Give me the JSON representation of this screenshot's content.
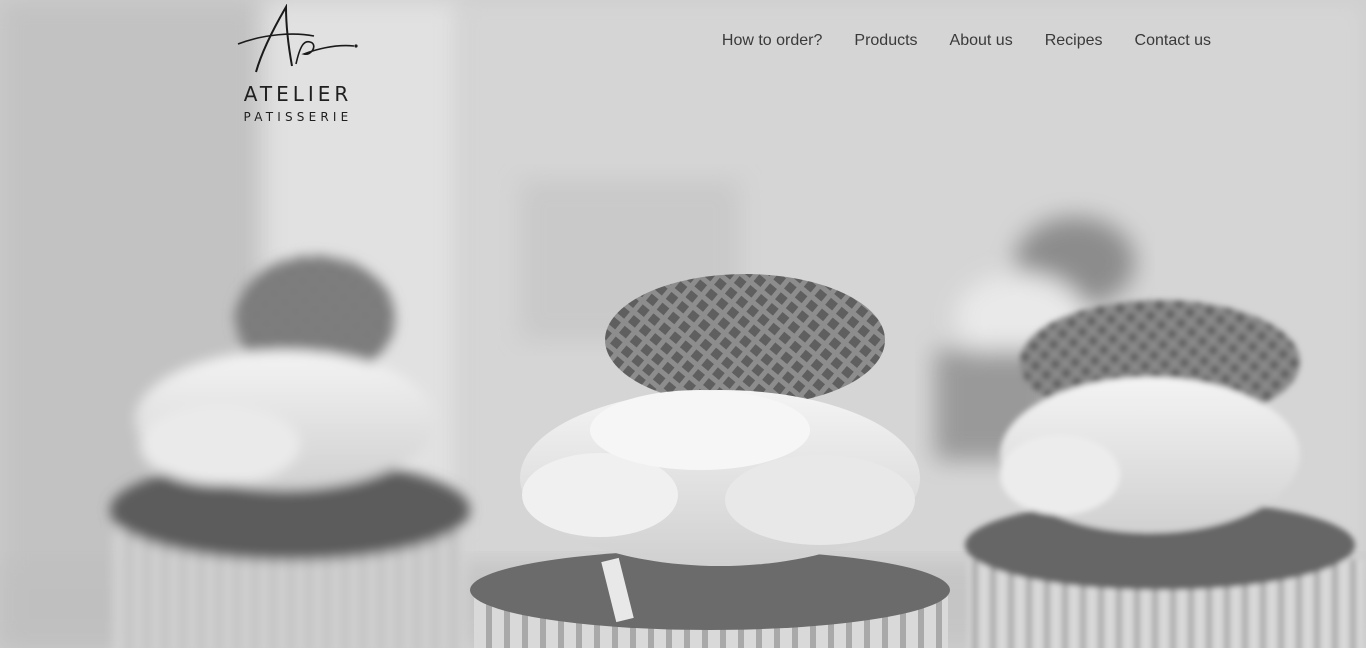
{
  "brand": {
    "monogram": "Ap",
    "name": "ATELIER",
    "tagline": "PATISSERIE"
  },
  "nav": {
    "items": [
      {
        "label": "How to order?"
      },
      {
        "label": "Products"
      },
      {
        "label": "About us"
      },
      {
        "label": "Recipes"
      },
      {
        "label": "Contact us"
      }
    ]
  },
  "hero": {
    "image": "cupcakes-with-waffle-cookie-topping",
    "tone": "grayscale"
  }
}
